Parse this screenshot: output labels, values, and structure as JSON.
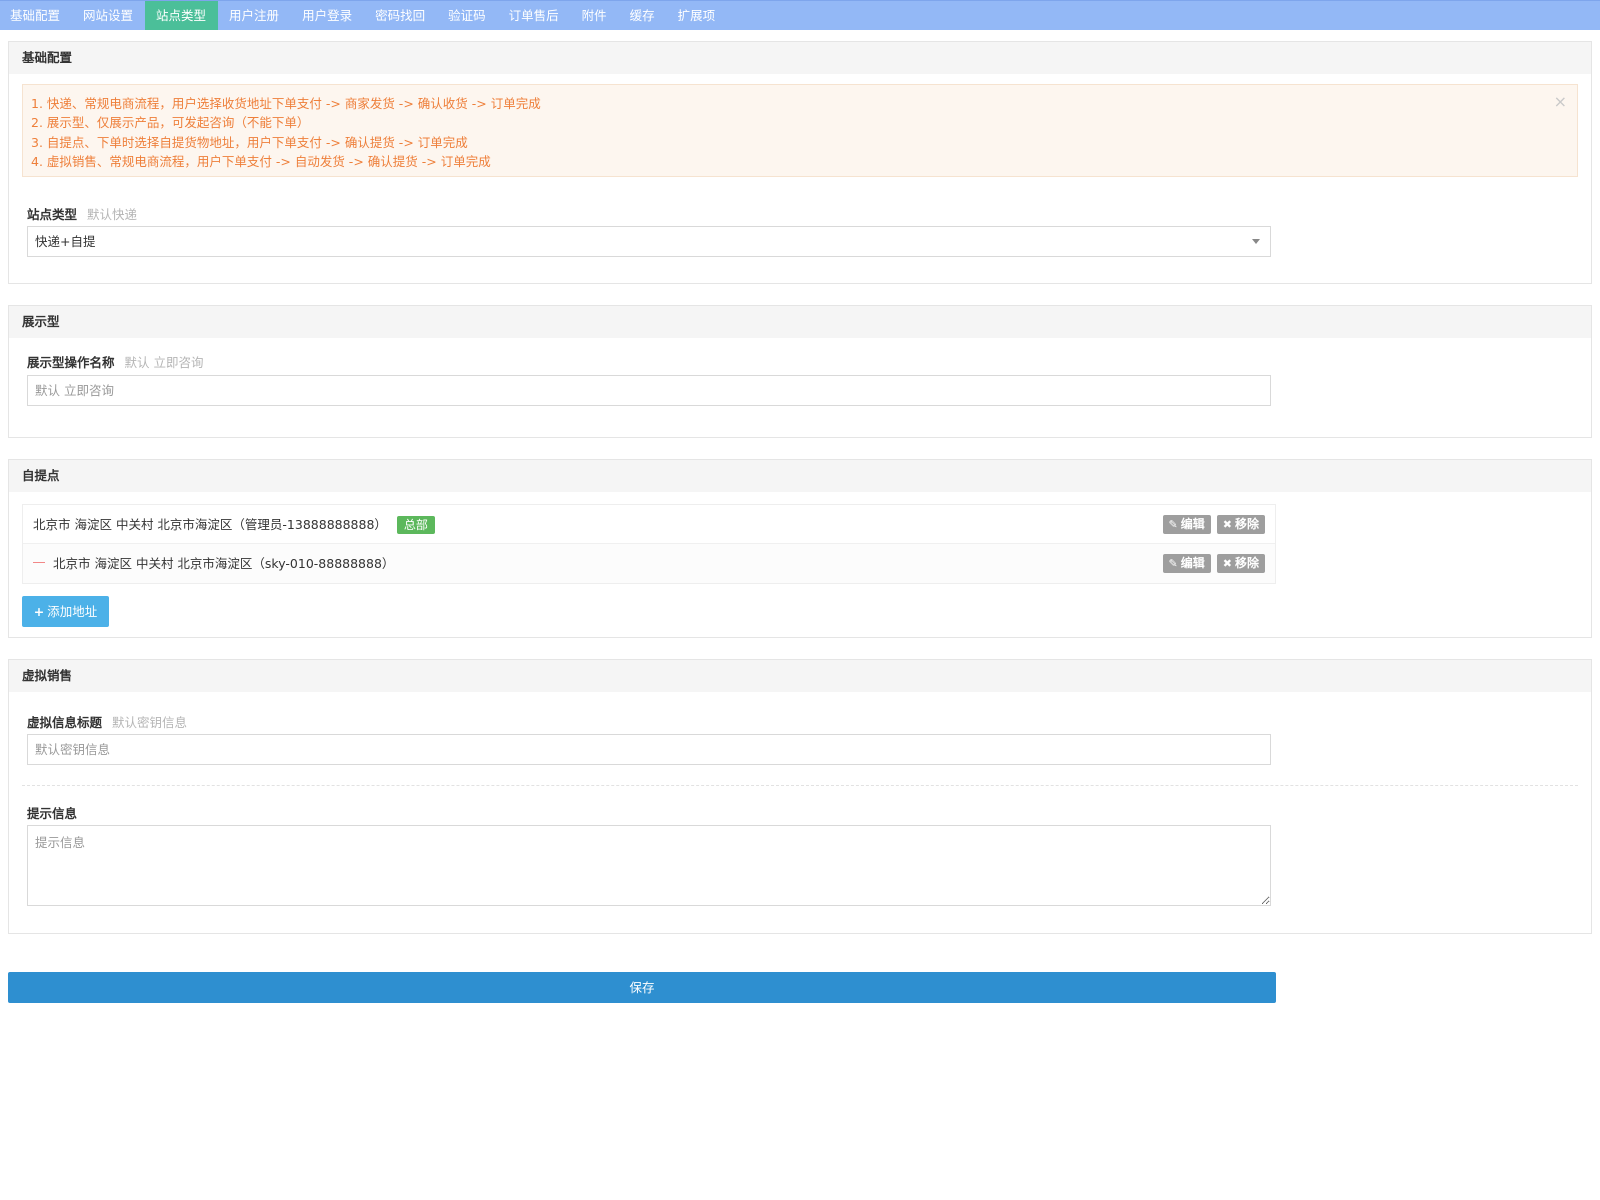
{
  "tabs": [
    {
      "label": "基础配置",
      "active": false
    },
    {
      "label": "网站设置",
      "active": false
    },
    {
      "label": "站点类型",
      "active": true
    },
    {
      "label": "用户注册",
      "active": false
    },
    {
      "label": "用户登录",
      "active": false
    },
    {
      "label": "密码找回",
      "active": false
    },
    {
      "label": "验证码",
      "active": false
    },
    {
      "label": "订单售后",
      "active": false
    },
    {
      "label": "附件",
      "active": false
    },
    {
      "label": "缓存",
      "active": false
    },
    {
      "label": "扩展项",
      "active": false
    }
  ],
  "basic": {
    "title": "基础配置",
    "notes": [
      "1. 快递、常规电商流程，用户选择收货地址下单支付 -> 商家发货 -> 确认收货 -> 订单完成",
      "2. 展示型、仅展示产品，可发起咨询（不能下单）",
      "3. 自提点、下单时选择自提货物地址，用户下单支付 -> 确认提货 -> 订单完成",
      "4. 虚拟销售、常规电商流程，用户下单支付 -> 自动发货 -> 确认提货 -> 订单完成"
    ],
    "close_glyph": "×",
    "site_type_label": "站点类型",
    "site_type_hint": "默认快递",
    "site_type_value": "快递+自提"
  },
  "display": {
    "title": "展示型",
    "op_name_label": "展示型操作名称",
    "op_name_hint": "默认 立即咨询",
    "op_name_placeholder": "默认 立即咨询"
  },
  "pickup": {
    "title": "自提点",
    "addresses": [
      {
        "text": "北京市 海淀区 中关村 北京市海淀区（管理员-13888888888）",
        "badge": "总部"
      },
      {
        "text": "北京市 海淀区 中关村 北京市海淀区（sky-010-88888888）",
        "badge": ""
      }
    ],
    "edit_label": "编辑",
    "remove_label": "移除",
    "add_label": "添加地址"
  },
  "virtual": {
    "title": "虚拟销售",
    "info_title_label": "虚拟信息标题",
    "info_title_hint": "默认密钥信息",
    "info_title_placeholder": "默认密钥信息",
    "tip_label": "提示信息",
    "tip_placeholder": "提示信息"
  },
  "save_label": "保存",
  "colors": {
    "tabbar": "#93b8f6",
    "tab_active": "#4bbf99",
    "alert_text": "#ee7f3a",
    "badge": "#5cb85c",
    "add_button": "#4cb1e8",
    "save_button": "#2e8fd0"
  }
}
